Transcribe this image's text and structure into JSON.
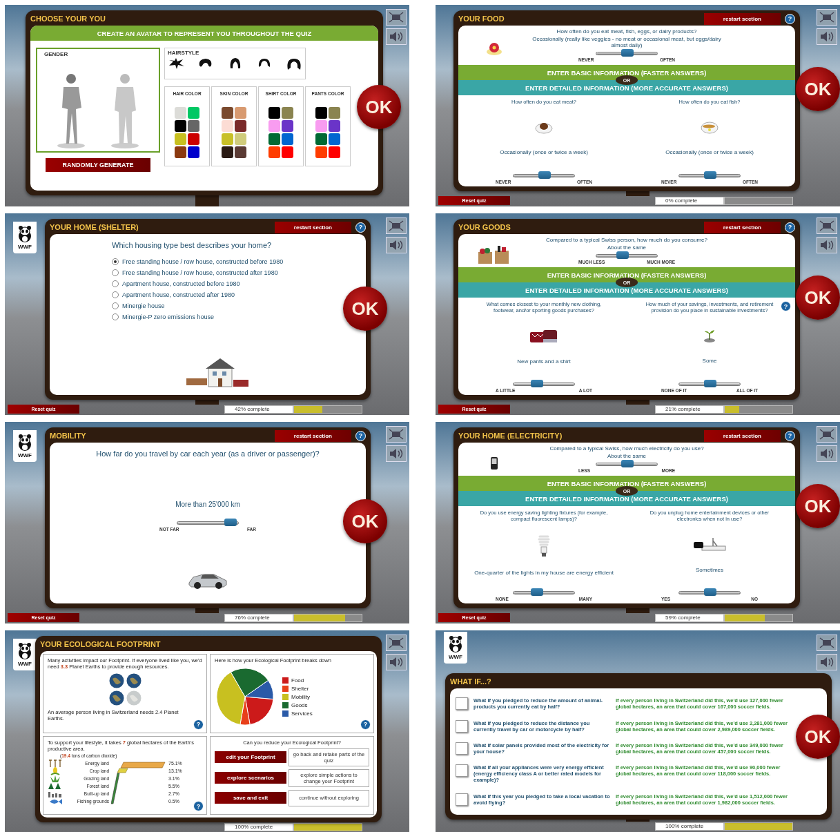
{
  "screens": [
    {
      "kind": "avatar",
      "title": "CHOOSE YOUR YOU",
      "banner": "CREATE AN AVATAR TO REPRESENT YOU THROUGHOUT THE QUIZ",
      "gender_label": "GENDER",
      "hairstyle_label": "HAIRSTYLE",
      "color_groups": [
        {
          "label": "HAIR COLOR",
          "swatches": [
            {
              "color": "#dcdcd8"
            },
            {
              "color": "#00c864"
            },
            {
              "color": "#000000"
            },
            {
              "color": "#666666"
            },
            {
              "color": "#c8c020"
            },
            {
              "color": "#cc0000"
            },
            {
              "color": "#8b3a10"
            },
            {
              "color": "#0000cc"
            }
          ]
        },
        {
          "label": "SKIN COLOR",
          "swatches": [
            {
              "color": "#7a4a2e"
            },
            {
              "color": "#d89a70"
            },
            {
              "color": "#fcdcd4"
            },
            {
              "color": "#7a2a2a"
            },
            {
              "color": "#c8c028"
            },
            {
              "color": "#d0cc7c"
            },
            {
              "color": "#2a1a14"
            },
            {
              "color": "#5a3a34"
            }
          ]
        },
        {
          "label": "SHIRT COLOR",
          "swatches": [
            {
              "color": "#000000"
            },
            {
              "color": "#8a8450"
            },
            {
              "color": "#f89cf0"
            },
            {
              "color": "#6a34c8"
            },
            {
              "color": "#006a34"
            },
            {
              "color": "#0066d0"
            },
            {
              "color": "#ff3c00"
            },
            {
              "color": "#ff0000"
            }
          ]
        },
        {
          "label": "PANTS COLOR",
          "swatches": [
            {
              "color": "#000000"
            },
            {
              "color": "#8a8450"
            },
            {
              "color": "#f89cf0"
            },
            {
              "color": "#6a34c8"
            },
            {
              "color": "#006a34"
            },
            {
              "color": "#0066d0"
            },
            {
              "color": "#ff3c00"
            },
            {
              "color": "#ff0000"
            }
          ]
        }
      ],
      "random_button": "RANDOMLY GENERATE",
      "ok": "OK"
    },
    {
      "kind": "quiz",
      "title": "YOUR FOOD",
      "restart": "restart section",
      "help": "?",
      "basic": {
        "question": "How often do you eat meat, fish, eggs, or dairy products?",
        "answer": "Occasionally (really like veggies - no meat or occasional meat, but eggs/dairy almost daily)",
        "level": 0.5,
        "low": "NEVER",
        "high": "OFTEN"
      },
      "basic_banner": "ENTER BASIC INFORMATION (FASTER ANSWERS)",
      "or": "OR",
      "detail_banner": "ENTER DETAILED INFORMATION (MORE ACCURATE ANSWERS)",
      "details": [
        {
          "question": "How often do you eat meat?",
          "answer": "Occasionally (once or twice a week)",
          "level": 0.5,
          "low": "NEVER",
          "high": "OFTEN"
        },
        {
          "question": "How often do you eat fish?",
          "answer": "Occasionally (once or twice a week)",
          "level": 0.5,
          "low": "NEVER",
          "high": "OFTEN"
        }
      ],
      "ok": "OK",
      "reset": "Reset quiz",
      "progress": {
        "label": "0% complete",
        "level": 0
      }
    },
    {
      "kind": "choice",
      "title": "YOUR HOME (SHELTER)",
      "logo": "WWF",
      "restart": "restart section",
      "help": "?",
      "question": "Which housing type best describes your home?",
      "options": [
        {
          "label": "Free standing house / row house, constructed before 1980",
          "selected": true
        },
        {
          "label": "Free standing house / row house, constructed after 1980",
          "selected": false
        },
        {
          "label": "Apartment house, constructed before 1980",
          "selected": false
        },
        {
          "label": "Apartment house, constructed after 1980",
          "selected": false
        },
        {
          "label": "Minergie house",
          "selected": false
        },
        {
          "label": "Minergie-P zero emissions house",
          "selected": false
        }
      ],
      "ok": "OK",
      "reset": "Reset quiz",
      "progress": {
        "label": "42% complete",
        "level": 0.42
      }
    },
    {
      "kind": "quiz",
      "title": "YOUR GOODS",
      "restart": "restart section",
      "help": "?",
      "basic": {
        "question": "Compared to a typical Swiss person, how much do you consume?",
        "answer": "About the same",
        "level": 0.4,
        "low": "MUCH LESS",
        "high": "MUCH MORE"
      },
      "basic_banner": "ENTER BASIC INFORMATION (FASTER ANSWERS)",
      "or": "OR",
      "detail_banner": "ENTER DETAILED INFORMATION (MORE ACCURATE ANSWERS)",
      "details": [
        {
          "question": "What comes closest to your monthly new clothing, footwear, and/or sporting goods purchases?",
          "answer": "New pants and a shirt",
          "level": 0.35,
          "low": "A LITTLE",
          "high": "A LOT"
        },
        {
          "question": "How much of your savings, investments, and retirement provision do you place in sustainable investments?",
          "answer": "Some",
          "level": 0.5,
          "low": "NONE OF IT",
          "high": "ALL OF IT",
          "help": "?"
        }
      ],
      "ok": "OK",
      "reset": "Reset quiz",
      "progress": {
        "label": "21% complete",
        "level": 0.21
      }
    },
    {
      "kind": "range",
      "title": "MOBILITY",
      "logo": "WWF",
      "restart": "restart section",
      "help": "?",
      "question": "How far do you travel by car each year (as a driver or passenger)?",
      "answer": "More than 25'000 km",
      "level": 0.95,
      "low": "NOT FAR",
      "high": "FAR",
      "ok": "OK",
      "reset": "Reset quiz",
      "progress": {
        "label": "76% complete",
        "level": 0.76
      }
    },
    {
      "kind": "quiz",
      "title": "YOUR HOME (ELECTRICITY)",
      "restart": "restart section",
      "help": "?",
      "basic": {
        "question": "Compared to a typical Swiss, how much electricity do you use?",
        "answer": "About the same",
        "level": 0.5,
        "low": "LESS",
        "high": "MORE"
      },
      "basic_banner": "ENTER BASIC INFORMATION (FASTER ANSWERS)",
      "or": "OR",
      "detail_banner": "ENTER DETAILED INFORMATION (MORE ACCURATE ANSWERS)",
      "details": [
        {
          "question": "Do you use energy saving lighting fixtures (for example, compact fluorescent lamps)?",
          "answer": "One-quarter of the lights in my house are energy efficient",
          "level": 0.35,
          "low": "NONE",
          "high": "MANY"
        },
        {
          "question": "Do you unplug home entertainment devices or other electronics when not in use?",
          "answer": "Sometimes",
          "level": 0.5,
          "low": "YES",
          "high": "NO"
        }
      ],
      "ok": "OK",
      "reset": "Reset quiz",
      "progress": {
        "label": "59% complete",
        "level": 0.59
      }
    },
    {
      "kind": "footprint",
      "title": "YOUR ECOLOGICAL FOOTPRINT",
      "logo": "WWF",
      "earths": {
        "text": "Many activities impact our Footprint. If everyone lived like you, we'd need **3.3** Planet Earths to provide enough resources.",
        "note": "An average person living in Switzerland needs 2.4 Planet Earths.",
        "help": "?"
      },
      "breakdown": {
        "title": "Here is how your Ecological Footprint breaks down",
        "legend": [
          {
            "label": "Food",
            "color": "#cc1a1a"
          },
          {
            "label": "Shelter",
            "color": "#e8401a"
          },
          {
            "label": "Mobility",
            "color": "#c8c020"
          },
          {
            "label": "Goods",
            "color": "#1a6a30"
          },
          {
            "label": "Services",
            "color": "#2a5aa8"
          }
        ],
        "help": "?"
      },
      "lifestyle": {
        "text": "To support your lifestyle, it takes **7** global hectares of the Earth's productive area.",
        "carbon": "(**19.4** tons of carbon dioxide)",
        "lands": [
          {
            "label": "Energy land",
            "share": "75.1%"
          },
          {
            "label": "Crop land",
            "share": "13.1%"
          },
          {
            "label": "Grazing land",
            "share": "3.1%"
          },
          {
            "label": "Forest land",
            "share": "5.5%"
          },
          {
            "label": "Built-up land",
            "share": "2.7%"
          },
          {
            "label": "Fishing grounds",
            "share": "0.5%"
          }
        ],
        "help": "?"
      },
      "reduce": {
        "title": "Can you reduce your Ecological Footprint?",
        "actions": [
          {
            "button": "edit your Footprint",
            "description": "go back and retake parts of the quiz"
          },
          {
            "button": "explore scenarios",
            "description": "explore simple actions to change your Footprint"
          },
          {
            "button": "save and exit",
            "description": "continue without exploring"
          }
        ]
      },
      "progress": {
        "label": "100% complete",
        "level": 1
      }
    },
    {
      "kind": "whatif",
      "title": "WHAT IF...?",
      "logo": "WWF",
      "items": [
        {
          "question": "What if you pledged to reduce the amount of animal-products you currently eat by half?",
          "result": "If every person living in Switzerland did this, we'd use 127,000 fewer global hectares, an area that could cover 167,000 soccer fields.",
          "checked": false
        },
        {
          "question": "What if you pledged to reduce the distance you currently travel by car or motorcycle by half?",
          "result": "If every person living in Switzerland did this, we'd use 2,281,000 fewer global hectares, an area that could cover 2,989,000 soccer fields.",
          "checked": false
        },
        {
          "question": "What if solar panels provided most of the electricity for your house?",
          "result": "If every person living in Switzerland did this, we'd use 349,000 fewer global hectares, an area that could cover 457,000 soccer fields.",
          "checked": false
        },
        {
          "question": "What if all your appliances were very energy efficient (energy efficiency class A or better rated models for example)?",
          "result": "If every person living in Switzerland did this, we'd use 90,000 fewer global hectares, an area that could cover 118,000 soccer fields.",
          "checked": false
        },
        {
          "question": "What if this year you pledged to take a local vacation to avoid flying?",
          "result": "If every person living in Switzerland did this, we'd use 1,512,000 fewer global hectares, an area that could cover 1,982,000 soccer fields.",
          "checked": false
        }
      ],
      "ok": "OK",
      "progress": {
        "label": "100% complete",
        "level": 1
      }
    }
  ]
}
